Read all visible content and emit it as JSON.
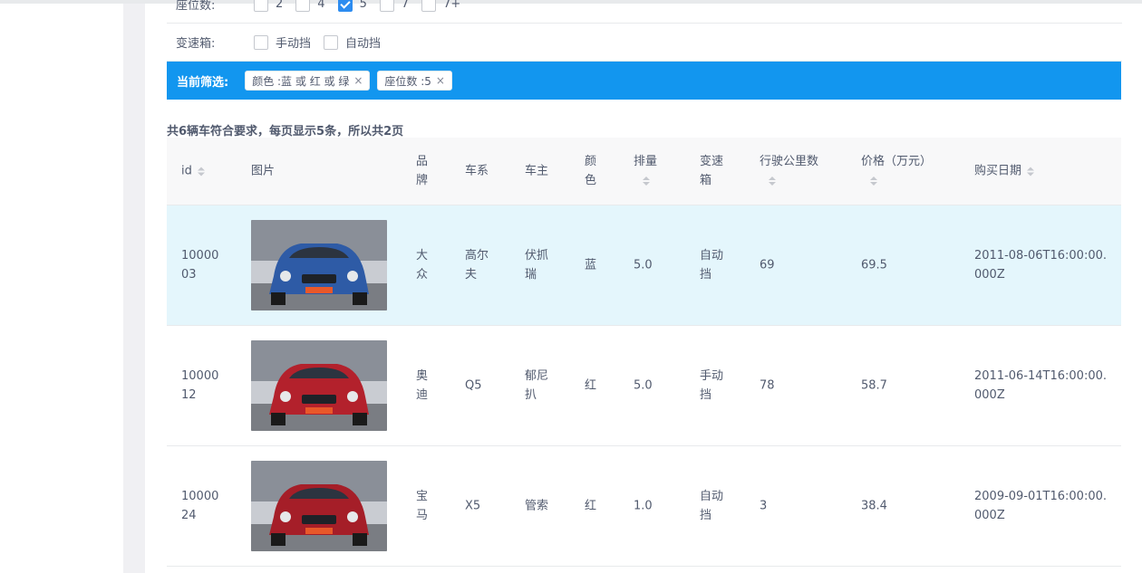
{
  "filters": {
    "seats": {
      "label": "座位数:",
      "options": [
        {
          "label": "2",
          "checked": false
        },
        {
          "label": "4",
          "checked": false
        },
        {
          "label": "5",
          "checked": true
        },
        {
          "label": "7",
          "checked": false
        },
        {
          "label": "7+",
          "checked": false
        }
      ]
    },
    "transmission": {
      "label": "变速箱:",
      "options": [
        {
          "label": "手动挡",
          "checked": false
        },
        {
          "label": "自动挡",
          "checked": false
        }
      ]
    }
  },
  "current": {
    "label": "当前筛选:",
    "tags": [
      {
        "text": "颜色 :蓝 或 红 或 绿"
      },
      {
        "text": "座位数 :5"
      }
    ],
    "close_glyph": "×"
  },
  "summary": "共6辆车符合要求，每页显示5条，所以共2页",
  "table": {
    "headers": {
      "id": "id",
      "image": "图片",
      "brand": "品牌",
      "series": "车系",
      "owner": "车主",
      "color": "颜色",
      "displacement": "排量",
      "transmission": "变速箱",
      "mileage": "行驶公里数",
      "price": "价格（万元）",
      "date": "购买日期"
    },
    "rows": [
      {
        "id": "1000003",
        "brand": "大众",
        "series": "高尔夫",
        "owner": "伏抓瑞",
        "color": "蓝",
        "displacement": "5.0",
        "transmission": "自动挡",
        "mileage": "69",
        "price": "69.5",
        "date": "2011-08-06T16:00:00.000Z",
        "car_color": "#2e5ba6"
      },
      {
        "id": "1000012",
        "brand": "奥迪",
        "series": "Q5",
        "owner": "郁尼扒",
        "color": "红",
        "displacement": "5.0",
        "transmission": "手动挡",
        "mileage": "78",
        "price": "58.7",
        "date": "2011-06-14T16:00:00.000Z",
        "car_color": "#b3212c"
      },
      {
        "id": "1000024",
        "brand": "宝马",
        "series": "X5",
        "owner": "管索",
        "color": "红",
        "displacement": "1.0",
        "transmission": "自动挡",
        "mileage": "3",
        "price": "38.4",
        "date": "2009-09-01T16:00:00.000Z",
        "car_color": "#a51e28"
      }
    ]
  },
  "colors": {
    "accent": "#1296ef",
    "highlight_row": "#e4f6fc",
    "checkbox_checked": "#2d8cf0"
  }
}
